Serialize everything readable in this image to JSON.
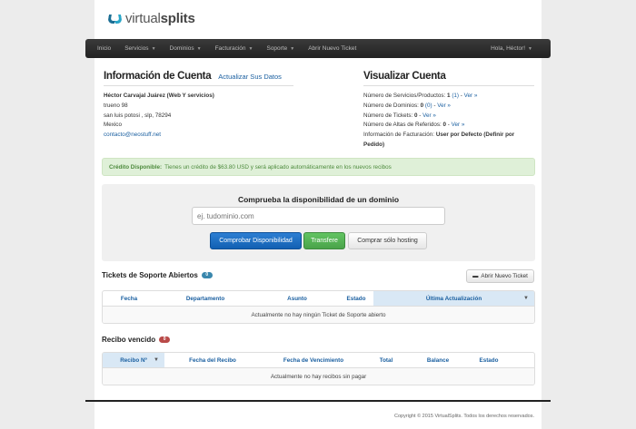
{
  "brand": {
    "name_light": "virtual",
    "name_bold": "splits"
  },
  "nav": {
    "items": [
      {
        "label": "Inicio",
        "caret": false
      },
      {
        "label": "Servicios",
        "caret": true
      },
      {
        "label": "Dominios",
        "caret": true
      },
      {
        "label": "Facturación",
        "caret": true
      },
      {
        "label": "Soporte",
        "caret": true
      },
      {
        "label": "Abrir Nuevo Ticket",
        "caret": false
      }
    ],
    "user": "Hola, Héctor!"
  },
  "account": {
    "title": "Información de Cuenta",
    "update_link": "Actualizar Sus Datos",
    "name": "Héctor Carvajal Juárez (Web Y servicios)",
    "address1": "trueno 98",
    "address2": "san luis potosi , slp, 78294",
    "country": "Mexico",
    "email": "contacto@neostuff.net"
  },
  "summary": {
    "title": "Visualizar Cuenta",
    "products_label": "Número de Servicios/Productos:",
    "products_count": "1",
    "products_active": "(1)",
    "domains_label": "Número de Dominios:",
    "domains_count": "0",
    "domains_active": "(0)",
    "tickets_label": "Número de Tickets:",
    "tickets_count": "0",
    "referrals_label": "Número de Altas de Referidos:",
    "referrals_count": "0",
    "view_link": "Ver »",
    "billing_label": "Información de Facturación:",
    "billing_value": "User por Defecto (Definir por Pedido)"
  },
  "credit": {
    "label": "Crédito Disponible:",
    "text": "Tienes un crédito de $63.80 USD y será aplicado automáticamente en los nuevos recibos"
  },
  "domain_check": {
    "title": "Comprueba la disponibilidad de un dominio",
    "placeholder": "ej. tudominio.com",
    "check_button": "Comprobar Disponibilidad",
    "transfer_button": "Transfere",
    "hosting_button": "Comprar sólo hosting"
  },
  "tickets": {
    "title": "Tickets de Soporte Abiertos",
    "count": "0",
    "new_button": "Abrir Nuevo Ticket",
    "columns": [
      "Fecha",
      "Departamento",
      "Asunto",
      "Estado",
      "Última Actualización"
    ],
    "empty": "Actualmente no hay ningún Ticket de Soporte abierto"
  },
  "invoices": {
    "title": "Recibo vencido",
    "count": "0",
    "columns": [
      "Recibo Nº",
      "Fecha del Recibo",
      "Fecha de Vencimiento",
      "Total",
      "Balance",
      "Estado"
    ],
    "empty": "Actualmente no hay recibos sin pagar"
  },
  "footer": {
    "copyright": "Copyright © 2015 VirtualSplits. Todos los derechos reservados."
  }
}
